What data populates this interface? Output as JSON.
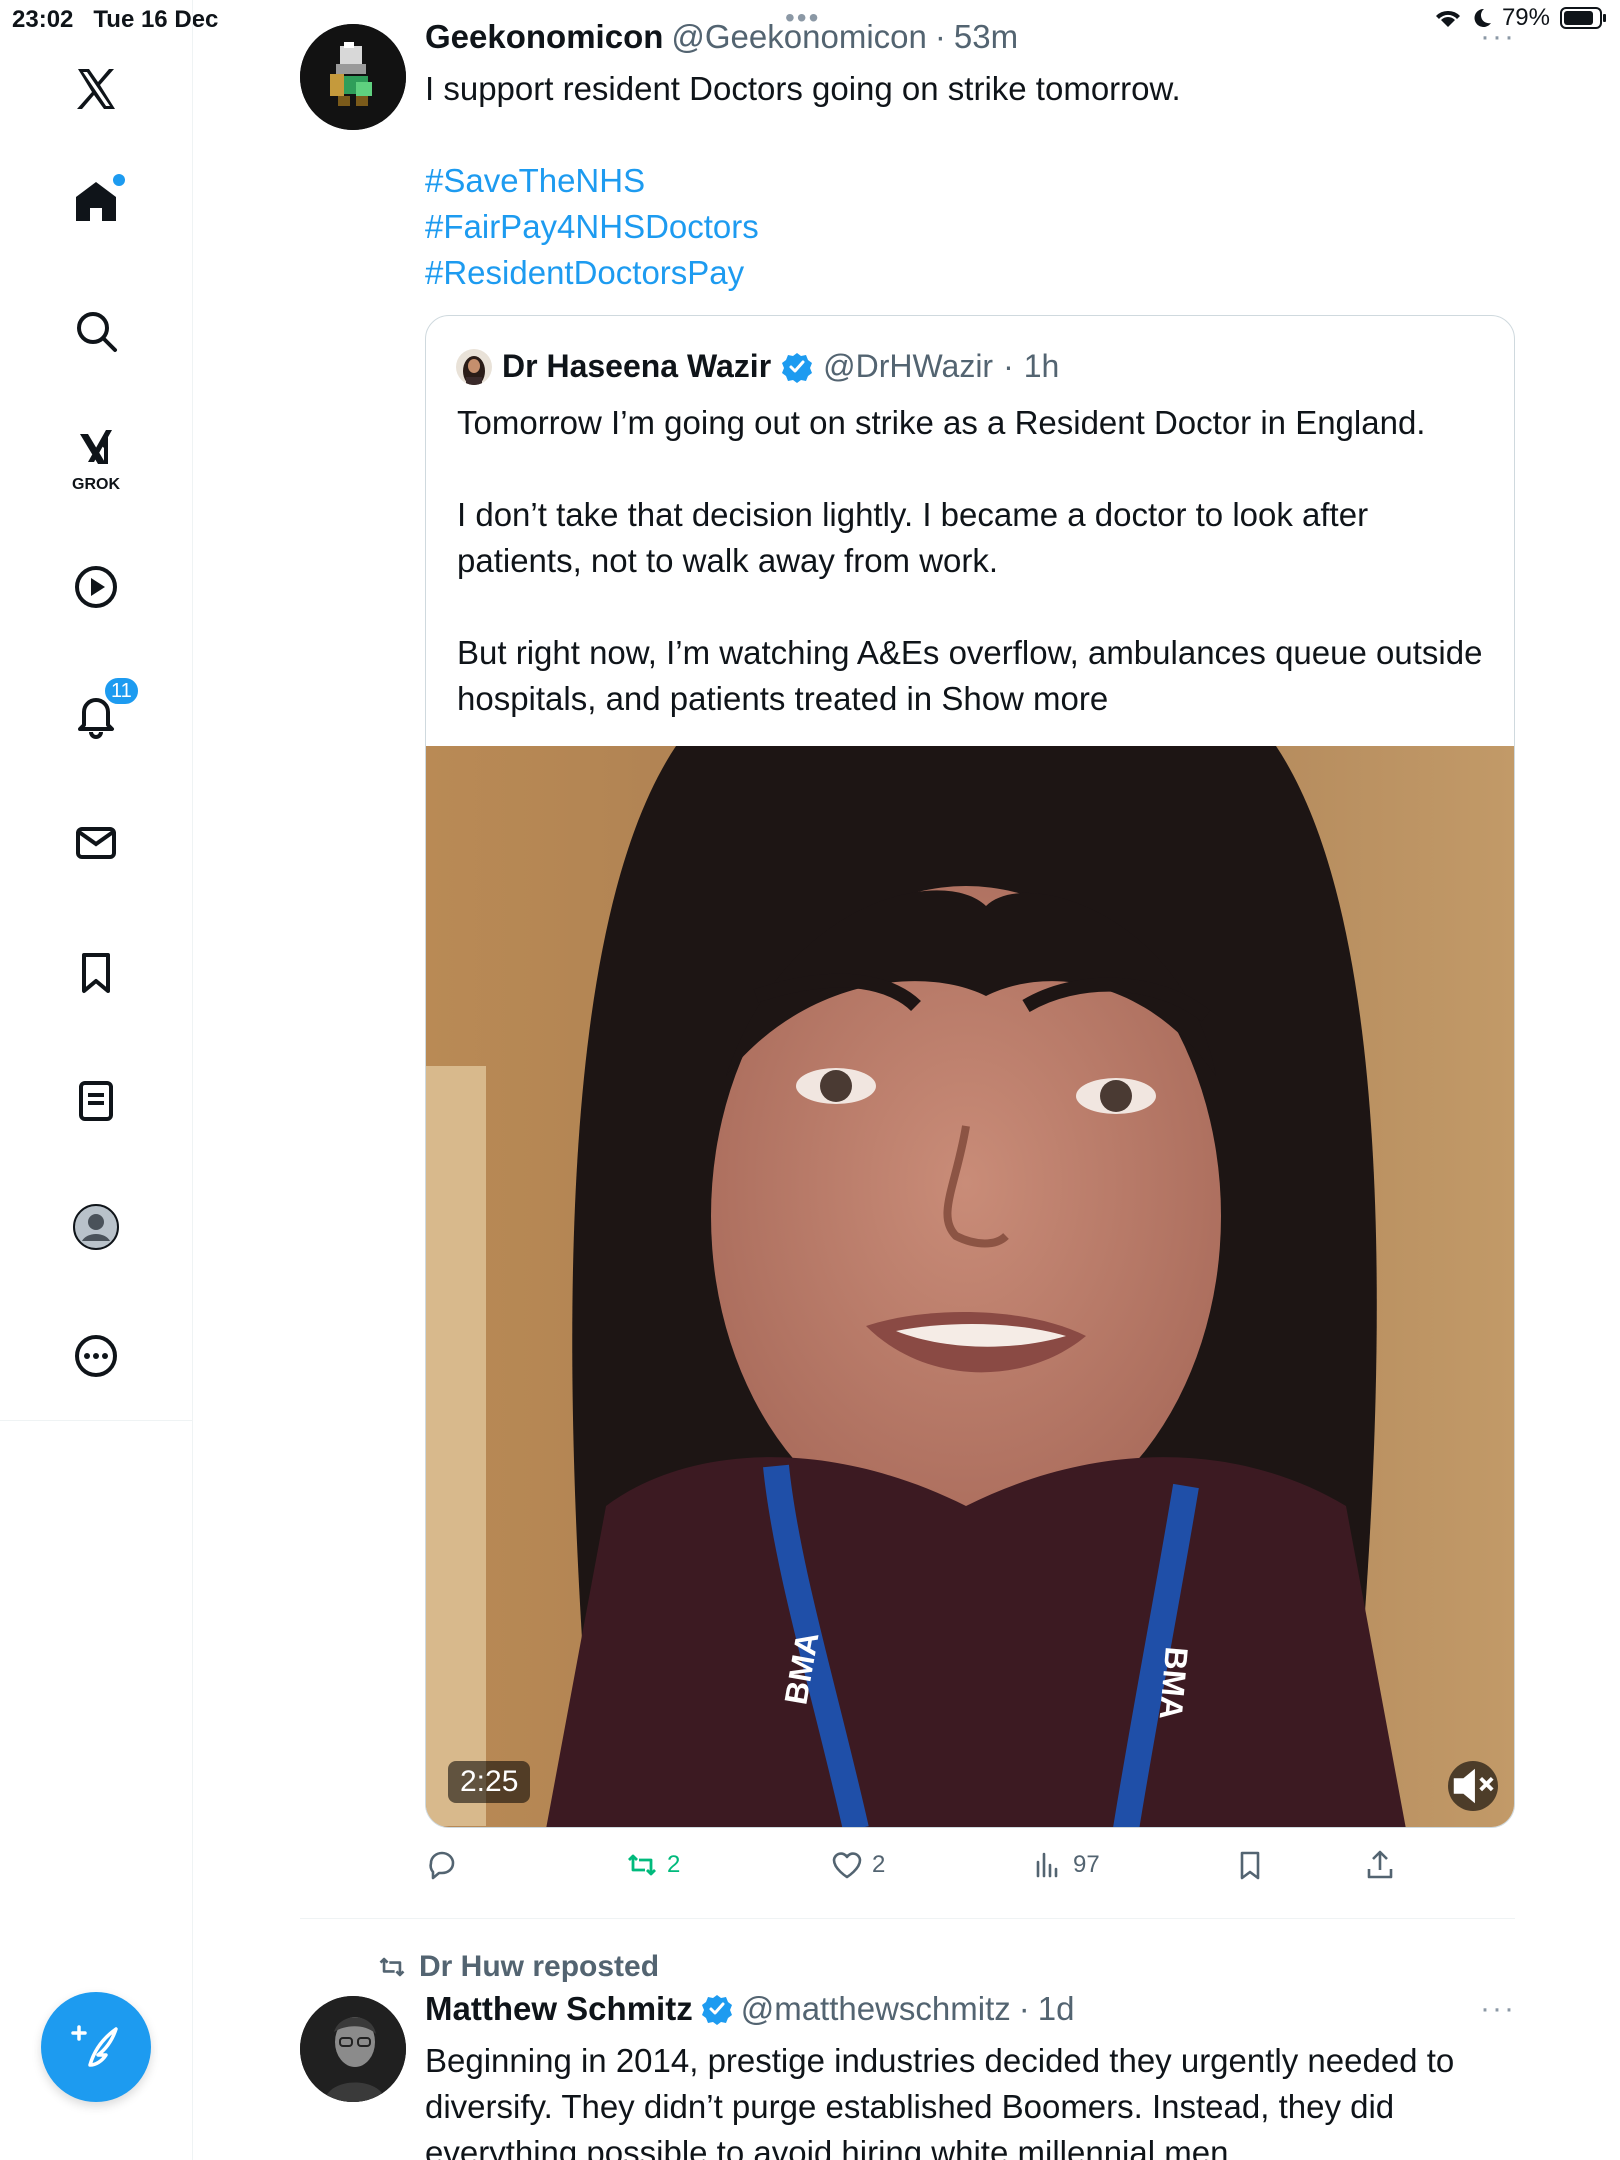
{
  "status_bar": {
    "time": "23:02",
    "date": "Tue 16 Dec",
    "battery": "79%"
  },
  "sidebar": {
    "items": [
      {
        "name": "x-logo"
      },
      {
        "name": "home",
        "has_dot": true
      },
      {
        "name": "search"
      },
      {
        "name": "grok",
        "label": "GROK"
      },
      {
        "name": "videos"
      },
      {
        "name": "notifications",
        "badge": "11"
      },
      {
        "name": "messages"
      },
      {
        "name": "bookmarks"
      },
      {
        "name": "lists"
      },
      {
        "name": "profile"
      },
      {
        "name": "more"
      }
    ]
  },
  "feed": {
    "tweet1": {
      "name": "Geekonomicon",
      "handle": "@Geekonomicon",
      "time": "53m",
      "text": "I support resident Doctors going on strike tomorrow.",
      "hashtags": [
        "#SaveTheNHS",
        "#FairPay4NHSDoctors",
        "#ResidentDoctorsPay"
      ],
      "quote": {
        "name": "Dr Haseena Wazir",
        "handle": "@DrHWazir",
        "time": "1h",
        "paragraphs": [
          "Tomorrow I’m going out on strike as a Resident Doctor in England.",
          "I don’t take that decision lightly. I became a doctor to look after patients, not to walk away from work.",
          "But right now, I’m watching A&Es overflow, ambulances queue outside hospitals, and patients treated in"
        ],
        "show_more": "Show more",
        "video_duration": "2:25",
        "lanyard_text": "BMA"
      },
      "actions": {
        "replies": "",
        "retweets": "2",
        "likes": "2",
        "views": "97"
      }
    },
    "tweet2": {
      "reposted_by": "Dr Huw reposted",
      "name": "Matthew Schmitz",
      "handle": "@matthewschmitz",
      "time": "1d",
      "text": "Beginning in 2014, prestige industries decided they urgently needed to diversify. They didn’t purge established Boomers. Instead, they did everything possible to avoid hiring white millennial men."
    }
  },
  "colors": {
    "accent": "#1d9bf0",
    "retweet": "#00ba7c",
    "secondary_text": "#536471"
  }
}
